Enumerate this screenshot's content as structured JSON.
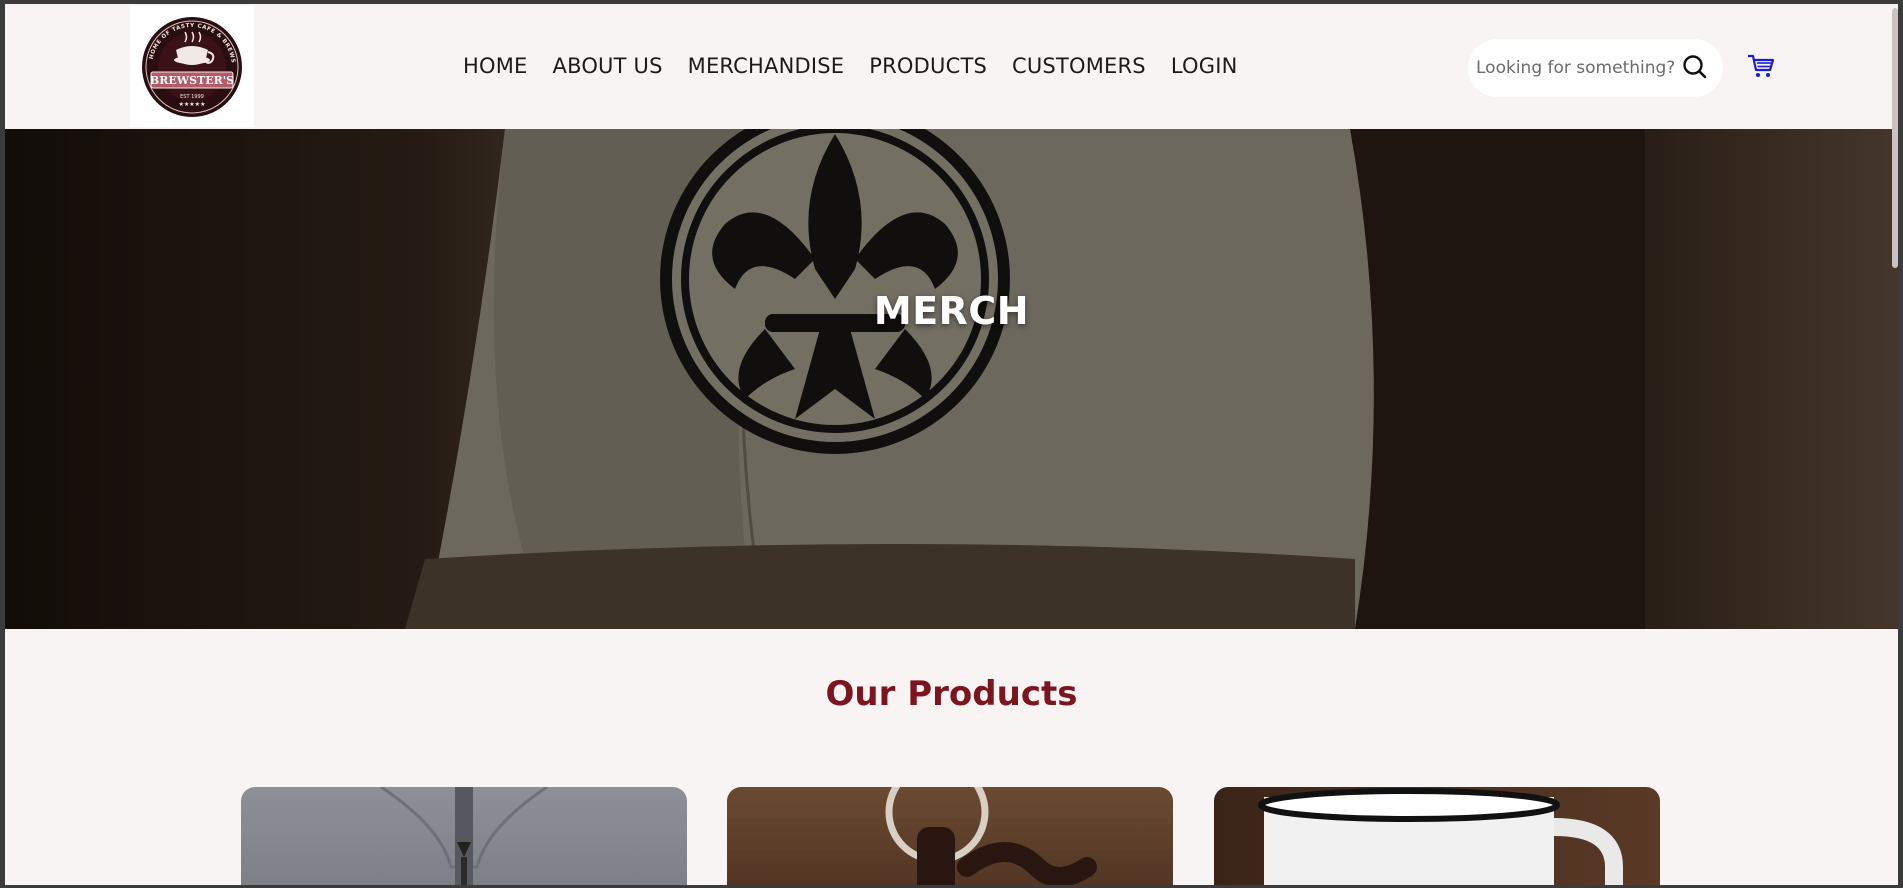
{
  "brand": {
    "name": "BREWSTER'S",
    "ring_text": "HOME OF TASTY CAFE & BREWS",
    "est": "EST 1999",
    "stars": "★★★★★"
  },
  "nav": {
    "items": [
      "HOME",
      "ABOUT US",
      "MERCHANDISE",
      "PRODUCTS",
      "CUSTOMERS",
      "LOGIN"
    ]
  },
  "search": {
    "placeholder": "Looking for something?",
    "icon": "search-icon"
  },
  "cart": {
    "icon": "cart-icon",
    "color": "#1a1ad8"
  },
  "hero": {
    "title": "MERCH",
    "image": "cap-with-fleur-de-lis-patch"
  },
  "products": {
    "title": "Our Products",
    "title_color": "#7b1520",
    "cards": [
      {
        "image": "grey-hoodie"
      },
      {
        "image": "leather-keychain"
      },
      {
        "image": "enamel-mug"
      }
    ]
  }
}
